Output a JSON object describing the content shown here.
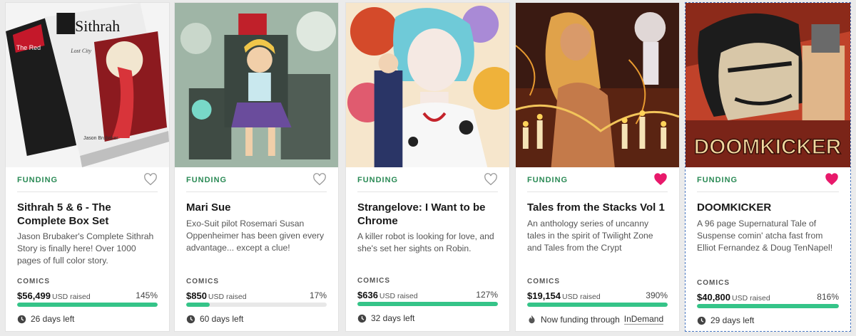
{
  "colors": {
    "funding": "#2a8a55",
    "progress": "#35c488",
    "heart_active": "#e8196b"
  },
  "cards": [
    {
      "status": "FUNDING",
      "favorited": false,
      "title": "Sithrah 5 & 6 - The Complete Box Set",
      "blurb": "Jason Brubaker's Complete Sithrah Story is finally here! Over 1000 pages of full color story.",
      "category": "COMICS",
      "amount": "$56,499",
      "currency_label": "USD raised",
      "percent_label": "145%",
      "percent": 145,
      "time_icon": "clock-icon",
      "time_text": "26 days left",
      "art": {
        "logo_text": "Sithrah",
        "sub_text": "Lost City",
        "author_text": "Jason Brubaker",
        "side_text": "The Red"
      }
    },
    {
      "status": "FUNDING",
      "favorited": false,
      "title": "Mari Sue",
      "blurb": "Exo-Suit pilot Rosemari Susan Oppenheimer has been given every advantage... except a clue!",
      "category": "COMICS",
      "amount": "$850",
      "currency_label": "USD raised",
      "percent_label": "17%",
      "percent": 17,
      "time_icon": "clock-icon",
      "time_text": "60 days left"
    },
    {
      "status": "FUNDING",
      "favorited": false,
      "title": "Strangelove: I Want to be Chrome",
      "blurb": "A killer robot is looking for love, and she's set her sights on Robin.",
      "category": "COMICS",
      "amount": "$636",
      "currency_label": "USD raised",
      "percent_label": "127%",
      "percent": 127,
      "time_icon": "clock-icon",
      "time_text": "32 days left"
    },
    {
      "status": "FUNDING",
      "favorited": true,
      "title": "Tales from the Stacks Vol 1",
      "blurb": "An anthology series of uncanny tales in the spirit of Twilight Zone and Tales from the Crypt",
      "category": "COMICS",
      "amount": "$19,154",
      "currency_label": "USD raised",
      "percent_label": "390%",
      "percent": 390,
      "time_icon": "fire-icon",
      "time_text": "Now funding through",
      "time_link": "InDemand"
    },
    {
      "status": "FUNDING",
      "favorited": true,
      "title": "DOOMKICKER",
      "blurb": "A 96 page Supernatural Tale of Suspense comin' atcha fast from Elliot Fernandez & Doug TenNapel!",
      "category": "COMICS",
      "amount": "$40,800",
      "currency_label": "USD raised",
      "percent_label": "816%",
      "percent": 816,
      "time_icon": "clock-icon",
      "time_text": "29 days left",
      "art": {
        "logo_text": "DOOMKICKER"
      }
    }
  ]
}
